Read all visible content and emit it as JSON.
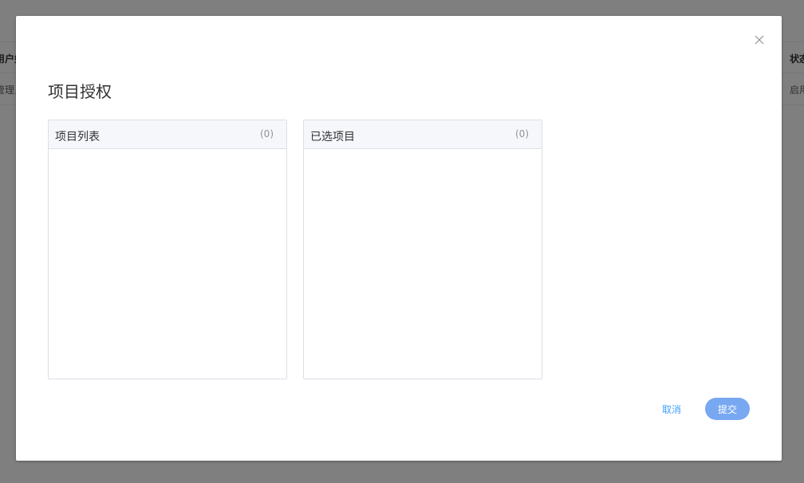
{
  "background": {
    "table_header_left": "用户姓",
    "table_header_right": "状态",
    "table_row_left": "管理员",
    "table_row_right": "启用"
  },
  "dialog": {
    "title": "项目授权",
    "close_icon": "close-icon",
    "transfer": {
      "left_panel": {
        "title": "项目列表",
        "count": "(0)"
      },
      "right_panel": {
        "title": "已选项目",
        "count": "(0)"
      }
    },
    "footer": {
      "cancel_label": "取消",
      "submit_label": "提交"
    }
  },
  "colors": {
    "accent": "#409eff",
    "submit_bg": "#79a8f2",
    "overlay": "rgba(0,0,0,0.5)"
  }
}
